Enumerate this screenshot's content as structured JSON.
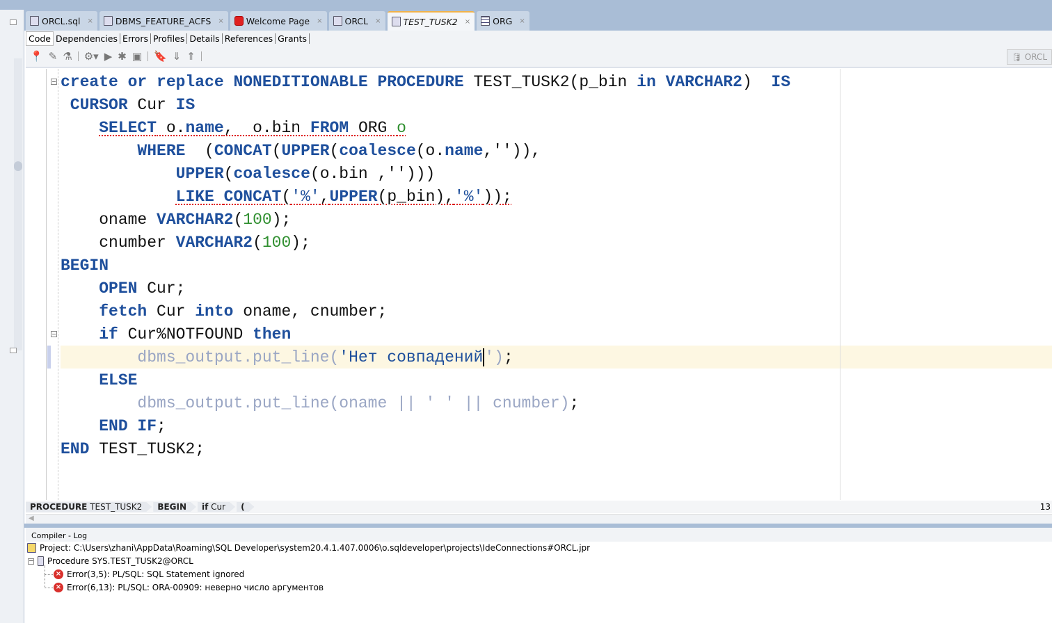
{
  "tabs": [
    {
      "label": "ORCL.sql",
      "icon": "sql-file-icon"
    },
    {
      "label": "DBMS_FEATURE_ACFS",
      "icon": "procedure-icon"
    },
    {
      "label": "Welcome Page",
      "icon": "oracle-icon"
    },
    {
      "label": "ORCL",
      "icon": "sql-worksheet-icon"
    },
    {
      "label": "TEST_TUSK2",
      "icon": "procedure-icon",
      "active": true
    },
    {
      "label": "ORG",
      "icon": "table-icon"
    }
  ],
  "close_glyph": "×",
  "subtabs": [
    "Code",
    "Dependencies",
    "Errors",
    "Profiles",
    "Details",
    "References",
    "Grants"
  ],
  "toolbar": {
    "connection": "ORCL"
  },
  "code": [
    [
      [
        "create or replace NONEDITIONABLE PROCEDURE",
        "kw"
      ],
      [
        " TEST_TUSK2(p_bin ",
        ""
      ],
      [
        "in VARCHAR2",
        "kw"
      ],
      [
        ")  ",
        ""
      ],
      [
        "IS",
        "kw"
      ]
    ],
    [
      [
        " CURSOR",
        "kw"
      ],
      [
        " Cur ",
        ""
      ],
      [
        "IS",
        "kw"
      ]
    ],
    [
      [
        "    ",
        ""
      ],
      [
        "SELECT",
        "kw err"
      ],
      [
        " o.",
        "err"
      ],
      [
        "name",
        "kw err"
      ],
      [
        ",  o.bin ",
        "err"
      ],
      [
        "FROM",
        "kw err"
      ],
      [
        " ORG ",
        "err"
      ],
      [
        "o",
        "num err"
      ]
    ],
    [
      [
        "        ",
        ""
      ],
      [
        "WHERE",
        "kw"
      ],
      [
        "  (",
        ""
      ],
      [
        "CONCAT",
        "kw"
      ],
      [
        "(",
        ""
      ],
      [
        "UPPER",
        "kw"
      ],
      [
        "(",
        ""
      ],
      [
        "coalesce",
        "kw"
      ],
      [
        "(o.",
        ""
      ],
      [
        "name",
        "kw"
      ],
      [
        ",'')),",
        ""
      ]
    ],
    [
      [
        "            ",
        ""
      ],
      [
        "UPPER",
        "kw"
      ],
      [
        "(",
        ""
      ],
      [
        "coalesce",
        "kw"
      ],
      [
        "(o.bin ,'')))",
        ""
      ]
    ],
    [
      [
        "            ",
        ""
      ],
      [
        "LIKE",
        "kw err"
      ],
      [
        " ",
        "err"
      ],
      [
        "CONCAT",
        "kw err"
      ],
      [
        "(",
        "err"
      ],
      [
        "'%'",
        "str err"
      ],
      [
        ",",
        "err"
      ],
      [
        "UPPER",
        "kw err"
      ],
      [
        "(p_bin),",
        "err"
      ],
      [
        "'%'",
        "str err"
      ],
      [
        "));",
        "err"
      ]
    ],
    [
      [
        "    oname ",
        ""
      ],
      [
        "VARCHAR2",
        "kw"
      ],
      [
        "(",
        ""
      ],
      [
        "100",
        "num"
      ],
      [
        ");",
        ""
      ]
    ],
    [
      [
        "    cnumber ",
        ""
      ],
      [
        "VARCHAR2",
        "kw"
      ],
      [
        "(",
        ""
      ],
      [
        "100",
        "num"
      ],
      [
        ");",
        ""
      ]
    ],
    [
      [
        "BEGIN",
        "kw"
      ]
    ],
    [
      [
        "    ",
        ""
      ],
      [
        "OPEN",
        "kw"
      ],
      [
        " Cur;",
        ""
      ]
    ],
    [
      [
        "    ",
        ""
      ],
      [
        "fetch",
        "kw"
      ],
      [
        " Cur ",
        ""
      ],
      [
        "into",
        "kw"
      ],
      [
        " oname, cnumber;",
        ""
      ]
    ],
    [
      [
        "    ",
        ""
      ],
      [
        "if",
        "kw"
      ],
      [
        " Cur%NOTFOUND ",
        ""
      ],
      [
        "then",
        "kw"
      ]
    ],
    [
      [
        "        ",
        ""
      ],
      [
        "dbms_output.put_line(",
        "dim"
      ],
      [
        "'Нет совпадений",
        "str caret"
      ],
      [
        "')",
        "dim"
      ],
      [
        ";",
        ""
      ]
    ],
    [
      [
        "    ",
        ""
      ],
      [
        "ELSE",
        "kw"
      ]
    ],
    [
      [
        "        ",
        ""
      ],
      [
        "dbms_output.put_line(oname || ' ' || cnumber)",
        "dim"
      ],
      [
        ";",
        ""
      ]
    ],
    [
      [
        "    ",
        ""
      ],
      [
        "END IF",
        "kw"
      ],
      [
        ";",
        ""
      ]
    ],
    [
      [
        "END",
        "kw"
      ],
      [
        " TEST_TUSK2;",
        ""
      ]
    ]
  ],
  "breadcrumbs": [
    {
      "bold": "PROCEDURE",
      "rest": " TEST_TUSK2"
    },
    {
      "bold": "BEGIN",
      "rest": ""
    },
    {
      "bold": "if",
      "rest": " Cur"
    },
    {
      "bold": "(",
      "rest": ""
    }
  ],
  "status": {
    "line": "13"
  },
  "log": {
    "title": "Compiler - Log",
    "project": "Project: C:\\Users\\zhani\\AppData\\Roaming\\SQL Developer\\system20.4.1.407.0006\\o.sqldeveloper\\projects\\IdeConnections#ORCL.jpr",
    "procedure": "Procedure SYS.TEST_TUSK2@ORCL",
    "errors": [
      "Error(3,5): PL/SQL: SQL Statement ignored",
      "Error(6,13): PL/SQL: ORA-00909: неверно число аргументов"
    ]
  }
}
